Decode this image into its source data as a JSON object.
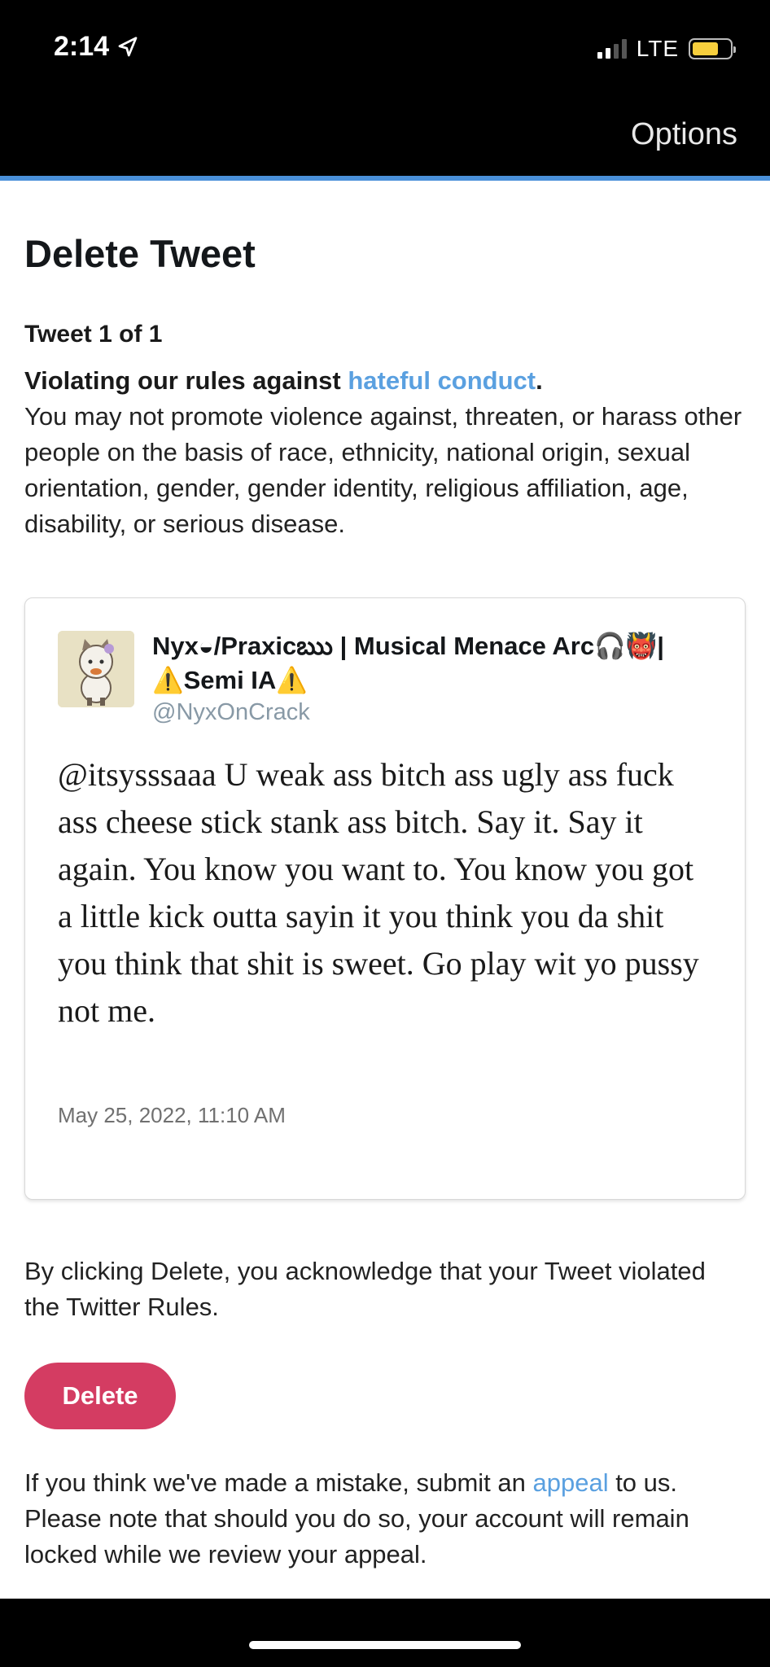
{
  "status_bar": {
    "time": "2:14",
    "network": "LTE",
    "icons": [
      "location-arrow-icon",
      "signal-icon",
      "battery-icon"
    ],
    "battery_color": "#f7cf3d"
  },
  "header": {
    "options_label": "Options",
    "accent_color": "#4a90d9"
  },
  "main": {
    "title": "Delete Tweet",
    "tweet_count": "Tweet 1 of 1",
    "violation": {
      "prefix": "Violating our rules against ",
      "link_text": "hateful conduct",
      "suffix": ".",
      "description": "You may not promote violence against, threaten, or harass other people on the basis of race, ethnicity, national origin, sexual orientation, gender, gender identity, religious affiliation, age, disability, or serious disease."
    },
    "tweet": {
      "display_name_line1": "Nyx◒/Praxicఋ | Musical Menace Arc🎧👹|",
      "display_name_line2": "⚠️Semi IA⚠️",
      "handle": "@NyxOnCrack",
      "text": "@itsysssaaa U weak ass bitch ass ugly ass fuck ass cheese stick stank ass bitch. Say it. Say it again. You know you want to. You know you got a little kick outta sayin it you think you da shit you think that shit is sweet. Go play wit yo pussy not me.",
      "date": "May 25, 2022, 11:10 AM"
    },
    "acknowledge_text": "By clicking Delete, you acknowledge that your Tweet violated the Twitter Rules.",
    "delete_label": "Delete",
    "delete_color": "#d43c62",
    "appeal": {
      "prefix": "If you think we've made a mistake, submit an ",
      "link_text": "appeal",
      "suffix": " to us. Please note that should you do so, your account will remain locked while we review your appeal."
    },
    "link_color": "#5aa0e0"
  }
}
